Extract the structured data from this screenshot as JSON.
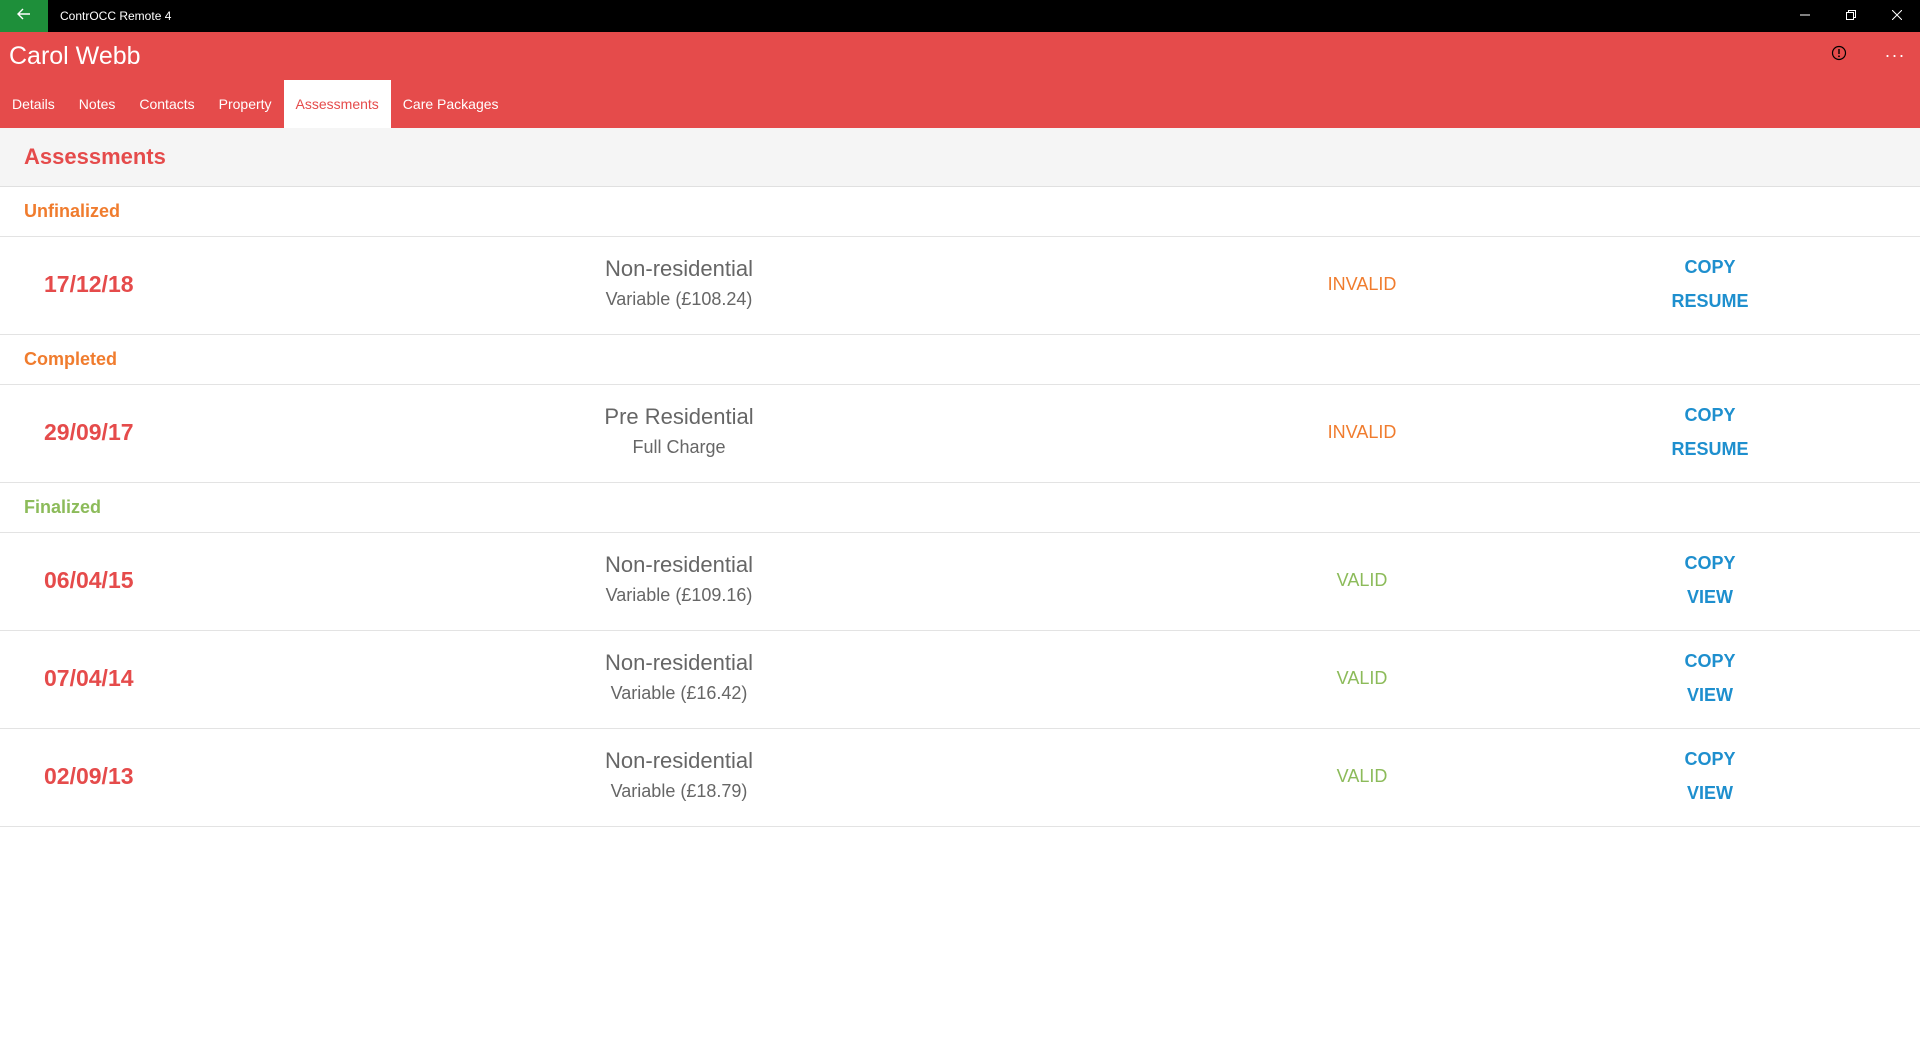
{
  "window": {
    "title": "ContrOCC Remote 4"
  },
  "header": {
    "person_name": "Carol Webb",
    "more_label": "···"
  },
  "tabs": [
    {
      "label": "Details",
      "active": false
    },
    {
      "label": "Notes",
      "active": false
    },
    {
      "label": "Contacts",
      "active": false
    },
    {
      "label": "Property",
      "active": false
    },
    {
      "label": "Assessments",
      "active": true
    },
    {
      "label": "Care Packages",
      "active": false
    }
  ],
  "page": {
    "title": "Assessments"
  },
  "colors": {
    "accent": "#e54b4b",
    "section_unfinalized": "#f07c2e",
    "section_completed": "#f07c2e",
    "section_finalized": "#8cbb5a",
    "invalid": "#f07c2e",
    "valid": "#8cbb5a",
    "action": "#1e8fce"
  },
  "sections": [
    {
      "label": "Unfinalized",
      "rows": [
        {
          "date": "17/12/18",
          "type": "Non-residential",
          "charge": "Variable (£108.24)",
          "status": "INVALID",
          "action1": "COPY",
          "action2": "RESUME"
        }
      ]
    },
    {
      "label": "Completed",
      "rows": [
        {
          "date": "29/09/17",
          "type": "Pre Residential",
          "charge": "Full Charge",
          "status": "INVALID",
          "action1": "COPY",
          "action2": "RESUME"
        }
      ]
    },
    {
      "label": "Finalized",
      "rows": [
        {
          "date": "06/04/15",
          "type": "Non-residential",
          "charge": "Variable (£109.16)",
          "status": "VALID",
          "action1": "COPY",
          "action2": "VIEW"
        },
        {
          "date": "07/04/14",
          "type": "Non-residential",
          "charge": "Variable (£16.42)",
          "status": "VALID",
          "action1": "COPY",
          "action2": "VIEW"
        },
        {
          "date": "02/09/13",
          "type": "Non-residential",
          "charge": "Variable (£18.79)",
          "status": "VALID",
          "action1": "COPY",
          "action2": "VIEW"
        }
      ]
    }
  ]
}
